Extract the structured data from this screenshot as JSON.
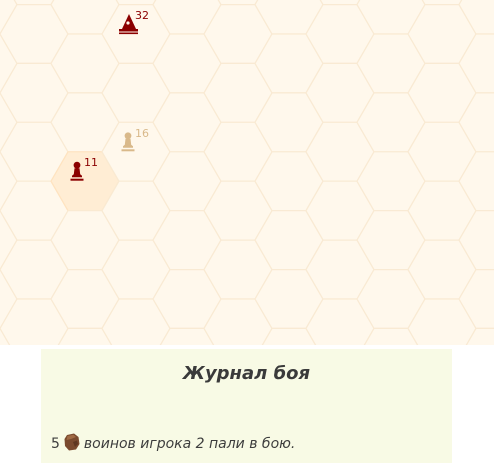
{
  "board": {
    "units": [
      {
        "name": "unit-wizard",
        "icon": "wizard-icon",
        "count": "32",
        "color": "#8b0000",
        "col": 2,
        "row": 0,
        "highlight": false
      },
      {
        "name": "unit-pawn-red",
        "icon": "pawn-icon",
        "count": "11",
        "color": "#8b0000",
        "col": 1,
        "row": 2,
        "highlight": true
      },
      {
        "name": "unit-pawn-tan",
        "icon": "pawn-icon",
        "count": "16",
        "color": "#d9b98a",
        "col": 2,
        "row": 2,
        "highlight": false
      }
    ]
  },
  "log": {
    "title": "Журнал боя",
    "entry": {
      "count": "5",
      "icon": "rock-icon",
      "text": "воинов игрока 2 пали в бою."
    }
  }
}
